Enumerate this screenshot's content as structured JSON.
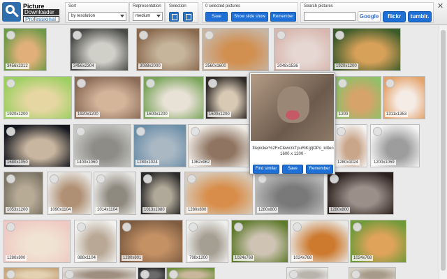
{
  "logo": {
    "line1": "Picture",
    "line2": "Downloader",
    "line3": "Professional"
  },
  "sort": {
    "label": "Sort",
    "value": "by resolution"
  },
  "representation": {
    "label": "Representation",
    "value": "medium"
  },
  "selection": {
    "label": "Selection"
  },
  "selected": {
    "label": "0 selected pictures",
    "save": "Save",
    "slideshow": "Show slide show",
    "remember": "Remember"
  },
  "search": {
    "label": "Search pictures",
    "value": "",
    "google": "Google",
    "flickr": "flickr",
    "tumblr": "tumblr."
  },
  "close_glyph": "✕",
  "thumbnails": [
    {
      "size": "3456x2312",
      "c1": "#6d9a47",
      "c2": "#e1b07a"
    },
    {
      "size": "3456x2304",
      "c1": "#4a4a48",
      "c2": "#d0cfc8"
    },
    {
      "size": "3088x2000",
      "c1": "#8a6a4e",
      "c2": "#c6b49b"
    },
    {
      "size": "2560x1600",
      "c1": "#c8b5a2",
      "c2": "#d18f50"
    },
    {
      "size": "2048x1536",
      "c1": "#d8b7ae",
      "c2": "#e6d7d3"
    },
    {
      "size": "1920x1200",
      "c1": "#3b5b2a",
      "c2": "#d8a15a"
    },
    {
      "size": "1920x1200",
      "c1": "#9ccf60",
      "c2": "#e6d7a2"
    },
    {
      "size": "1920x1200",
      "c1": "#8a6b58",
      "c2": "#d4b59a"
    },
    {
      "size": "1600x1200",
      "c1": "#7aa55a",
      "c2": "#e8e1d6"
    },
    {
      "size": "1600x1200",
      "c1": "#2f2a26",
      "c2": "#d8c9b5"
    },
    {
      "size": "1200",
      "c1": "#8fc06a",
      "c2": "#d6a36a"
    },
    {
      "size": "1311x1353",
      "c1": "#e4a36a",
      "c2": "#f5ece6"
    },
    {
      "size": "1680x1050",
      "c1": "#15171f",
      "c2": "#c8b6a0"
    },
    {
      "size": "1400x1060",
      "c1": "#c6c6c4",
      "c2": "#8d8c87"
    },
    {
      "size": "1280x1024",
      "c1": "#6c8fa9",
      "c2": "#aab8c4"
    },
    {
      "size": "1362x962",
      "c1": "#f0ede8",
      "c2": "#8f7461"
    },
    {
      "size": "1280x1024",
      "c1": "#f4f4f4",
      "c2": "#c9a58a"
    },
    {
      "size": "1200x1059",
      "c1": "#f4f4f4",
      "c2": "#9d9d9d"
    },
    {
      "size": "1053x1200",
      "c1": "#7b7465",
      "c2": "#b7ab96"
    },
    {
      "size": "1090x1104",
      "c1": "#e8e7e3",
      "c2": "#b09074"
    },
    {
      "size": "1014x1104",
      "c1": "#e7e6e2",
      "c2": "#8f8a80"
    },
    {
      "size": "1013x1080",
      "c1": "#2a2a2a",
      "c2": "#b0a898"
    },
    {
      "size": "1280x800",
      "c1": "#d8cbbb",
      "c2": "#d88e4a"
    },
    {
      "size": "1280x800",
      "c1": "#bcbcbc",
      "c2": "#797979"
    },
    {
      "size": "1280x800",
      "c1": "#2a1f1c",
      "c2": "#9a8f89"
    },
    {
      "size": "1280x800",
      "c1": "#efc9c4",
      "c2": "#f0e3d2"
    },
    {
      "size": "888x1104",
      "c1": "#f1f1ef",
      "c2": "#b9a895"
    },
    {
      "size": "1280x801",
      "c1": "#7d5c41",
      "c2": "#c49165"
    },
    {
      "size": "798x1200",
      "c1": "#efefed",
      "c2": "#a59e92"
    },
    {
      "size": "1024x768",
      "c1": "#5e7a2b",
      "c2": "#cfc4b4"
    },
    {
      "size": "1024x768",
      "c1": "#e8e8e5",
      "c2": "#cd7a2f"
    },
    {
      "size": "1024x768",
      "c1": "#6e9a39",
      "c2": "#e0a35a"
    },
    {
      "size": "",
      "c1": "#c6a57a",
      "c2": "#e4d1b1"
    },
    {
      "size": "",
      "c1": "#ded9d2",
      "c2": "#9e8f80"
    },
    {
      "size": "",
      "c1": "#2c2c2c",
      "c2": "#6a6a6a"
    },
    {
      "size": "",
      "c1": "#6f8f3c",
      "c2": "#c8b79b"
    },
    {
      "size": "",
      "c1": "#e9e9e7",
      "c2": "#b8b4ab"
    },
    {
      "size": "",
      "c1": "#d7d1c5",
      "c2": "#a79b8a"
    }
  ],
  "popup": {
    "url": "filepicker%2FxClewcrkTpuRiKgtjOPo_kitten",
    "dimensions": "1600 x 1200 -",
    "find_similar": "Find similar",
    "save": "Save",
    "remember": "Remember"
  }
}
